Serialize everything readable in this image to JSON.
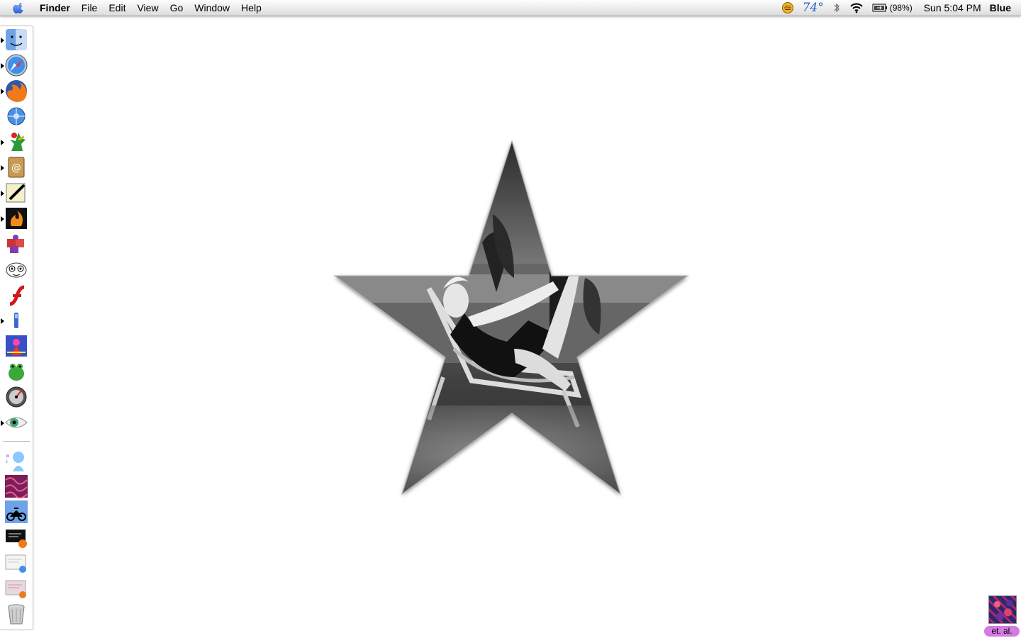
{
  "menubar": {
    "app_name": "Finder",
    "menus": [
      "File",
      "Edit",
      "View",
      "Go",
      "Window",
      "Help"
    ],
    "weather": "74°",
    "battery": "(98%)",
    "clock": "Sun 5:04 PM",
    "user": "Blue"
  },
  "desktop": {
    "icon_label": "et. al."
  },
  "dock": {
    "items": [
      {
        "icon": "finder-icon",
        "running": true
      },
      {
        "icon": "safari-icon",
        "running": true
      },
      {
        "icon": "firefox-icon",
        "running": true
      },
      {
        "icon": "camino-icon",
        "running": false
      },
      {
        "icon": "rooster-app-icon",
        "running": true
      },
      {
        "icon": "address-book-icon",
        "running": true
      },
      {
        "icon": "text-editor-icon",
        "running": true
      },
      {
        "icon": "fire-app-icon",
        "running": true
      },
      {
        "icon": "puzzle-app-icon",
        "running": false
      },
      {
        "icon": "adium-icon",
        "running": false
      },
      {
        "icon": "flash-icon",
        "running": false
      },
      {
        "icon": "stick-app-icon",
        "running": true
      },
      {
        "icon": "cartoon-app-icon",
        "running": false
      },
      {
        "icon": "frog-app-icon",
        "running": false
      },
      {
        "icon": "disk-utility-icon",
        "running": false
      },
      {
        "icon": "eye-app-icon",
        "running": true
      },
      {
        "icon": "character-folder-icon",
        "running": false
      },
      {
        "icon": "pattern-folder-icon",
        "running": false
      },
      {
        "icon": "motorbike-folder-icon",
        "running": false
      },
      {
        "icon": "firefox-window-icon",
        "running": false
      },
      {
        "icon": "safari-window-icon",
        "running": false
      },
      {
        "icon": "firefox-page-icon",
        "running": false
      },
      {
        "icon": "trash-icon",
        "running": false
      }
    ]
  }
}
